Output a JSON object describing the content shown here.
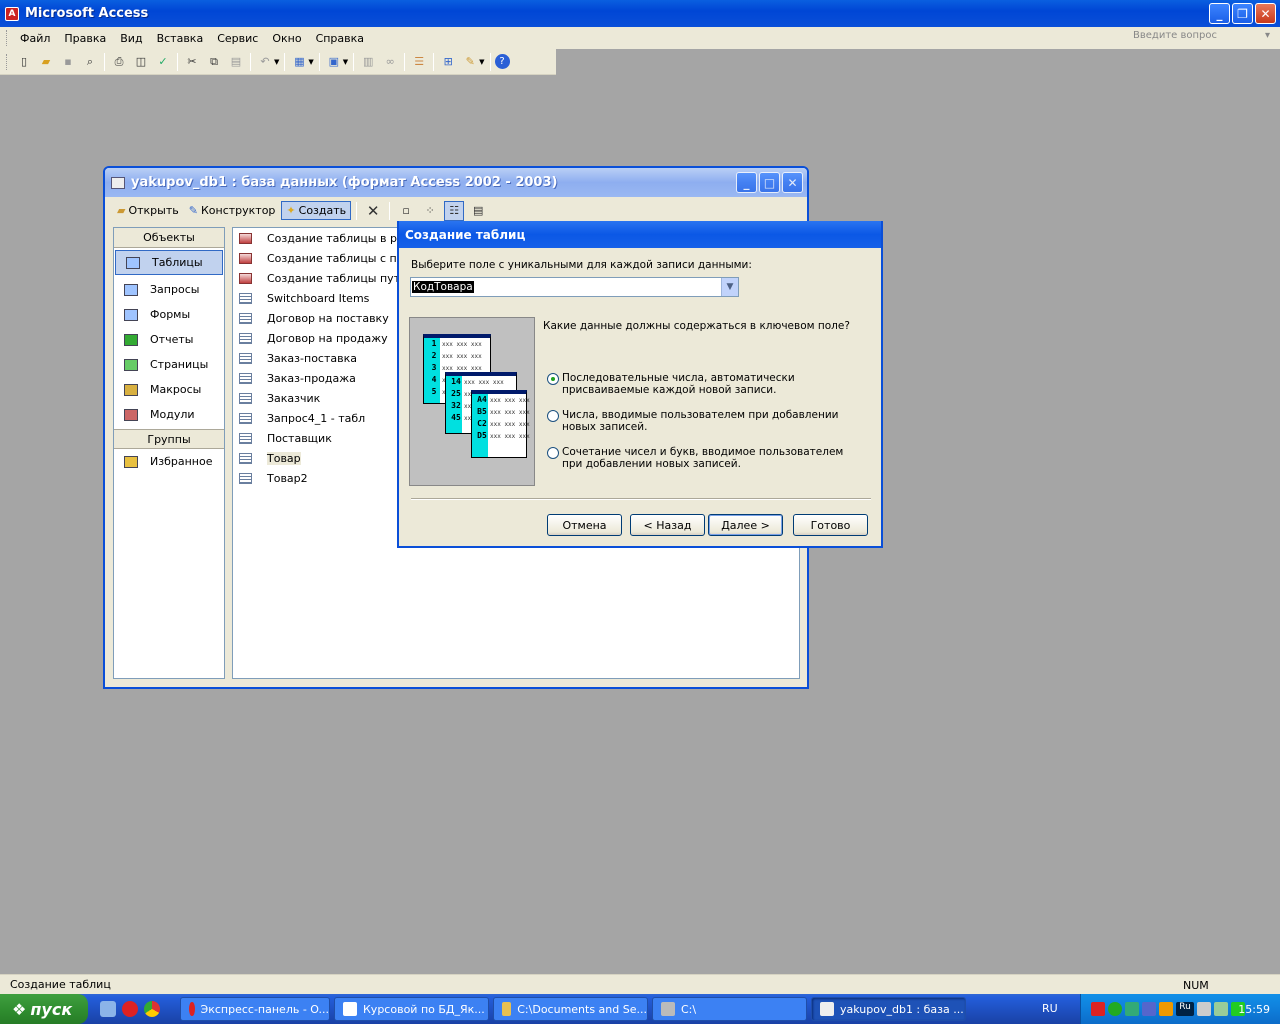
{
  "app": {
    "title": "Microsoft Access"
  },
  "menu": [
    {
      "label": "Файл"
    },
    {
      "label": "Правка"
    },
    {
      "label": "Вид"
    },
    {
      "label": "Вставка"
    },
    {
      "label": "Сервис"
    },
    {
      "label": "Окно"
    },
    {
      "label": "Справка"
    }
  ],
  "help_placeholder": "Введите вопрос",
  "db_window": {
    "title": "yakupov_db1 : база данных (формат Access 2002 - 2003)",
    "toolbar": {
      "open": "Открыть",
      "design": "Конструктор",
      "create": "Создать"
    },
    "objects_header": "Объекты",
    "objects": [
      {
        "label": "Таблицы"
      },
      {
        "label": "Запросы"
      },
      {
        "label": "Формы"
      },
      {
        "label": "Отчеты"
      },
      {
        "label": "Страницы"
      },
      {
        "label": "Макросы"
      },
      {
        "label": "Модули"
      }
    ],
    "groups_header": "Группы",
    "groups": [
      {
        "label": "Избранное"
      }
    ],
    "items": [
      {
        "label": "Создание таблицы в режиме конструктора"
      },
      {
        "label": "Создание таблицы с помощью мастера"
      },
      {
        "label": "Создание таблицы путем ввода данных"
      },
      {
        "label": "Switchboard Items"
      },
      {
        "label": "Договор на поставку"
      },
      {
        "label": "Договор на продажу"
      },
      {
        "label": "Заказ-поставка"
      },
      {
        "label": "Заказ-продажа"
      },
      {
        "label": "Заказчик"
      },
      {
        "label": "Запрос4_1 - табл"
      },
      {
        "label": "Поставщик"
      },
      {
        "label": "Товар"
      },
      {
        "label": "Товар2"
      }
    ]
  },
  "dialog": {
    "title": "Создание таблиц",
    "field_label": "Выберите поле с уникальными для каждой записи данными:",
    "field_value": "КодТовара",
    "question": "Какие данные должны содержаться в ключевом поле?",
    "options": [
      {
        "label": "Последовательные числа, автоматически присваиваемые каждой новой записи.",
        "selected": true
      },
      {
        "label": "Числа, вводимые пользователем при добавлении новых записей.",
        "selected": false
      },
      {
        "label": "Сочетание чисел и букв, вводимое пользователем при добавлении новых записей.",
        "selected": false
      }
    ],
    "illustration": {
      "sheet1": [
        "1",
        "2",
        "3",
        "4",
        "5"
      ],
      "sheet2": [
        "14",
        "25",
        "32",
        "45"
      ],
      "sheet3": [
        "A4",
        "B5",
        "C2",
        "D5"
      ],
      "filler": "xxx xxx xxx"
    },
    "buttons": {
      "cancel": "Отмена",
      "back": "< Назад",
      "next": "Далее >",
      "finish": "Готово"
    }
  },
  "status": {
    "text": "Создание таблиц",
    "num": "NUM"
  },
  "taskbar": {
    "start": "пуск",
    "tasks": [
      {
        "label": "Экспресс-панель - O..."
      },
      {
        "label": "Курсовой по БД_Як..."
      },
      {
        "label": "C:\\Documents and Se..."
      },
      {
        "label": "C:\\"
      },
      {
        "label": "yakupov_db1 : база ..."
      }
    ],
    "lang": "RU",
    "tray_lang": "Ru",
    "clock": "15:59"
  }
}
